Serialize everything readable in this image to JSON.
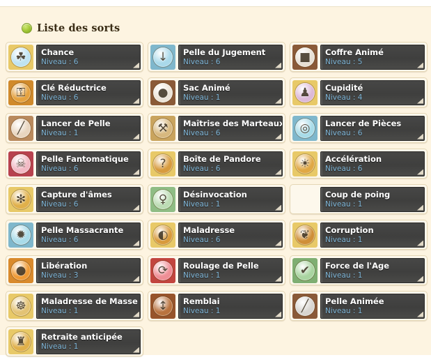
{
  "header": {
    "bullet_icon": "green-bullet-icon",
    "title": "Liste des sorts"
  },
  "labels": {
    "level_prefix": "Niveau : "
  },
  "colors": {
    "page_background": "#fdf4e1",
    "card_background": "#fdf8ec",
    "card_border": "#e4d6b4",
    "panel_dark": "#424241",
    "spell_name": "#ffffff",
    "level_text": "#7fb6d8",
    "title_text": "#3a2d16"
  },
  "spells": [
    {
      "name": "Chance",
      "level": "6",
      "level_text": "Niveau : 6",
      "icon": "clover-icon",
      "icon_bg": "#bfe3f2",
      "icon_frame": "#e8c968",
      "glyph": "☘"
    },
    {
      "name": "Pelle du Jugement",
      "level": "6",
      "level_text": "Niveau : 6",
      "icon": "shovel-judgement-icon",
      "icon_bg": "#a9d9ea",
      "icon_frame": "#7fb7cc",
      "glyph": "↓"
    },
    {
      "name": "Coffre Animé",
      "level": "5",
      "level_text": "Niveau : 5",
      "icon": "animated-chest-icon",
      "icon_bg": "#e7e0d4",
      "icon_frame": "#8a5a38",
      "glyph": "■"
    },
    {
      "name": "Clé Réductrice",
      "level": "6",
      "level_text": "Niveau : 6",
      "icon": "key-icon",
      "icon_bg": "#e5a23f",
      "icon_frame": "#d08a2c",
      "glyph": "⚿"
    },
    {
      "name": "Sac Animé",
      "level": "1",
      "level_text": "Niveau : 1",
      "icon": "animated-bag-icon",
      "icon_bg": "#ece4d8",
      "icon_frame": "#8a5a38",
      "glyph": "●"
    },
    {
      "name": "Cupidité",
      "level": "4",
      "level_text": "Niveau : 4",
      "icon": "greed-icon",
      "icon_bg": "#dcb9d8",
      "icon_frame": "#e8c968",
      "glyph": "♟"
    },
    {
      "name": "Lancer de Pelle",
      "level": "1",
      "level_text": "Niveau : 1",
      "icon": "shovel-throw-icon",
      "icon_bg": "#e8d5bf",
      "icon_frame": "#b98a5d",
      "glyph": "╱"
    },
    {
      "name": "Maîtrise des Marteaux",
      "level": "6",
      "level_text": "Niveau : 6",
      "icon": "hammer-mastery-icon",
      "icon_bg": "#d7b87e",
      "icon_frame": "#c9a45e",
      "glyph": "⚒"
    },
    {
      "name": "Lancer de Pièces",
      "level": "6",
      "level_text": "Niveau : 6",
      "icon": "coin-throw-icon",
      "icon_bg": "#a7dbe8",
      "icon_frame": "#7fb7cc",
      "glyph": "◎"
    },
    {
      "name": "Pelle Fantomatique",
      "level": "6",
      "level_text": "Niveau : 6",
      "icon": "ghost-shovel-icon",
      "icon_bg": "#f2b9c4",
      "icon_frame": "#b8424f",
      "glyph": "☠"
    },
    {
      "name": "Boîte de Pandore",
      "level": "6",
      "level_text": "Niveau : 6",
      "icon": "pandora-box-icon",
      "icon_bg": "#d79b3e",
      "icon_frame": "#e8c968",
      "glyph": "?"
    },
    {
      "name": "Accélération",
      "level": "6",
      "level_text": "Niveau : 6",
      "icon": "acceleration-icon",
      "icon_bg": "#e0a845",
      "icon_frame": "#e8c968",
      "glyph": "☀"
    },
    {
      "name": "Capture d'âmes",
      "level": "6",
      "level_text": "Niveau : 6",
      "icon": "soul-capture-icon",
      "icon_bg": "#e0b04a",
      "icon_frame": "#e8c968",
      "glyph": "✻"
    },
    {
      "name": "Désinvocation",
      "level": "1",
      "level_text": "Niveau : 1",
      "icon": "unsummon-icon",
      "icon_bg": "#bcdcb4",
      "icon_frame": "#8fbd85",
      "glyph": "♀"
    },
    {
      "name": "Coup de poing",
      "level": "1",
      "level_text": "Niveau : 1",
      "icon": "missing-icon",
      "icon_bg": "transparent",
      "icon_frame": "transparent",
      "glyph": ""
    },
    {
      "name": "Pelle Massacrante",
      "level": "6",
      "level_text": "Niveau : 6",
      "icon": "slaughter-shovel-icon",
      "icon_bg": "#a9dbe9",
      "icon_frame": "#7fb7cc",
      "glyph": "✹"
    },
    {
      "name": "Maladresse",
      "level": "6",
      "level_text": "Niveau : 6",
      "icon": "clumsiness-icon",
      "icon_bg": "#d89a3c",
      "icon_frame": "#e8c968",
      "glyph": "◐"
    },
    {
      "name": "Corruption",
      "level": "1",
      "level_text": "Niveau : 1",
      "icon": "corruption-icon",
      "icon_bg": "#cf8f37",
      "icon_frame": "#e8c968",
      "glyph": "❦"
    },
    {
      "name": "Libération",
      "level": "3",
      "level_text": "Niveau : 3",
      "icon": "liberation-icon",
      "icon_bg": "#ef9a35",
      "icon_frame": "#d98a2c",
      "glyph": "●"
    },
    {
      "name": "Roulage de Pelle",
      "level": "1",
      "level_text": "Niveau : 1",
      "icon": "shovel-roll-icon",
      "icon_bg": "#ef8e95",
      "icon_frame": "#c2453f",
      "glyph": "⟳"
    },
    {
      "name": "Force de l'Age",
      "level": "1",
      "level_text": "Niveau : 1",
      "icon": "age-strength-icon",
      "icon_bg": "#a9d4a0",
      "icon_frame": "#7fae72",
      "glyph": "✔"
    },
    {
      "name": "Maladresse de Masse",
      "level": "1",
      "level_text": "Niveau : 1",
      "icon": "mass-clumsiness-icon",
      "icon_bg": "#e3c374",
      "icon_frame": "#e8c968",
      "glyph": "☸"
    },
    {
      "name": "Remblai",
      "level": "1",
      "level_text": "Niveau : 1",
      "icon": "embankment-icon",
      "icon_bg": "#b9733f",
      "icon_frame": "#97542b",
      "glyph": "↕"
    },
    {
      "name": "Pelle Animée",
      "level": "1",
      "level_text": "Niveau : 1",
      "icon": "animated-shovel-icon",
      "icon_bg": "#d8d5d0",
      "icon_frame": "#8a5a38",
      "glyph": "╱"
    },
    {
      "name": "Retraite anticipée",
      "level": "1",
      "level_text": "Niveau : 1",
      "icon": "early-retirement-icon",
      "icon_bg": "#e0b04a",
      "icon_frame": "#e8c968",
      "glyph": "♜"
    }
  ]
}
